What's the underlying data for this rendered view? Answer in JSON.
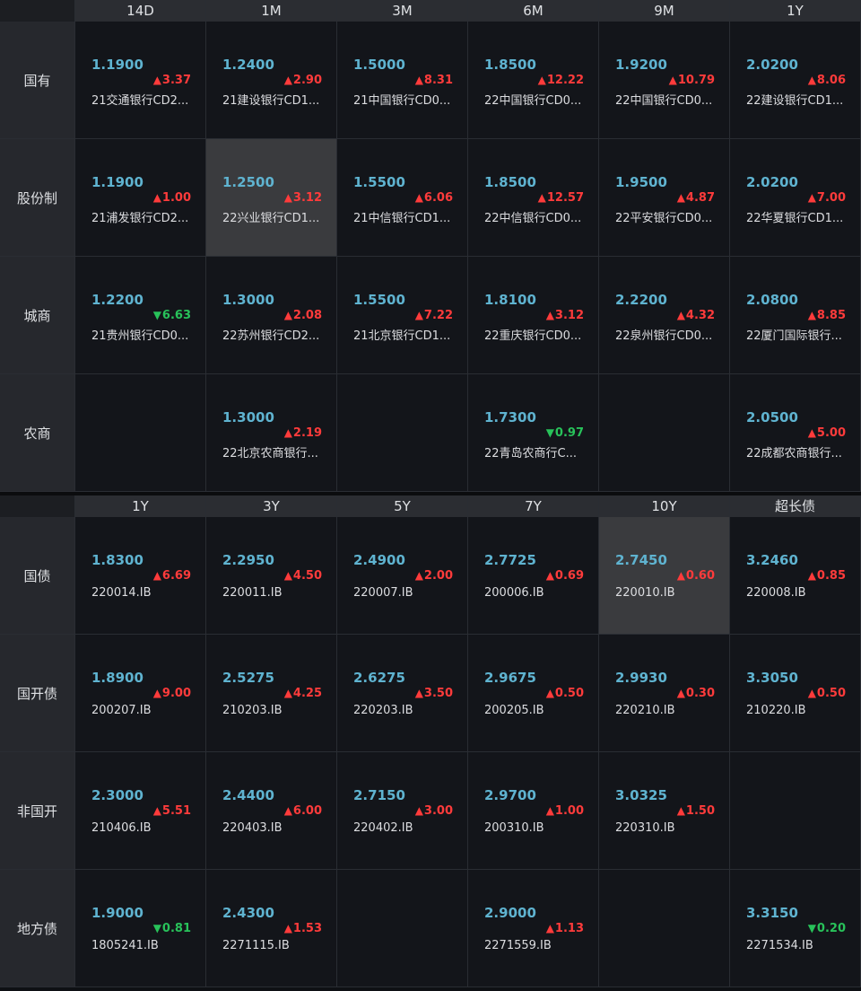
{
  "section1": {
    "columns": [
      "14D",
      "1M",
      "3M",
      "6M",
      "9M",
      "1Y"
    ],
    "rows": [
      {
        "label": "国有",
        "cells": [
          {
            "value": "1.1900",
            "dir": "up",
            "change": "3.37",
            "name": "21交通银行CD2..."
          },
          {
            "value": "1.2400",
            "dir": "up",
            "change": "2.90",
            "name": "21建设银行CD1..."
          },
          {
            "value": "1.5000",
            "dir": "up",
            "change": "8.31",
            "name": "21中国银行CD0..."
          },
          {
            "value": "1.8500",
            "dir": "up",
            "change": "12.22",
            "name": "22中国银行CD0..."
          },
          {
            "value": "1.9200",
            "dir": "up",
            "change": "10.79",
            "name": "22中国银行CD0..."
          },
          {
            "value": "2.0200",
            "dir": "up",
            "change": "8.06",
            "name": "22建设银行CD1..."
          }
        ]
      },
      {
        "label": "股份制",
        "cells": [
          {
            "value": "1.1900",
            "dir": "up",
            "change": "1.00",
            "name": "21浦发银行CD2..."
          },
          {
            "value": "1.2500",
            "dir": "up",
            "change": "3.12",
            "name": "22兴业银行CD1...",
            "highlight": true
          },
          {
            "value": "1.5500",
            "dir": "up",
            "change": "6.06",
            "name": "21中信银行CD1..."
          },
          {
            "value": "1.8500",
            "dir": "up",
            "change": "12.57",
            "name": "22中信银行CD0..."
          },
          {
            "value": "1.9500",
            "dir": "up",
            "change": "4.87",
            "name": "22平安银行CD0..."
          },
          {
            "value": "2.0200",
            "dir": "up",
            "change": "7.00",
            "name": "22华夏银行CD1..."
          }
        ]
      },
      {
        "label": "城商",
        "cells": [
          {
            "value": "1.2200",
            "dir": "down",
            "change": "6.63",
            "name": "21贵州银行CD0..."
          },
          {
            "value": "1.3000",
            "dir": "up",
            "change": "2.08",
            "name": "22苏州银行CD2..."
          },
          {
            "value": "1.5500",
            "dir": "up",
            "change": "7.22",
            "name": "21北京银行CD1..."
          },
          {
            "value": "1.8100",
            "dir": "up",
            "change": "3.12",
            "name": "22重庆银行CD0..."
          },
          {
            "value": "2.2200",
            "dir": "up",
            "change": "4.32",
            "name": "22泉州银行CD0..."
          },
          {
            "value": "2.0800",
            "dir": "up",
            "change": "8.85",
            "name": "22厦门国际银行..."
          }
        ]
      },
      {
        "label": "农商",
        "cells": [
          null,
          {
            "value": "1.3000",
            "dir": "up",
            "change": "2.19",
            "name": "22北京农商银行..."
          },
          null,
          {
            "value": "1.7300",
            "dir": "down",
            "change": "0.97",
            "name": "22青岛农商行C..."
          },
          null,
          {
            "value": "2.0500",
            "dir": "up",
            "change": "5.00",
            "name": "22成都农商银行..."
          }
        ]
      }
    ]
  },
  "section2": {
    "columns": [
      "1Y",
      "3Y",
      "5Y",
      "7Y",
      "10Y",
      "超长债"
    ],
    "rows": [
      {
        "label": "国债",
        "cells": [
          {
            "value": "1.8300",
            "dir": "up",
            "change": "6.69",
            "name": "220014.IB"
          },
          {
            "value": "2.2950",
            "dir": "up",
            "change": "4.50",
            "name": "220011.IB"
          },
          {
            "value": "2.4900",
            "dir": "up",
            "change": "2.00",
            "name": "220007.IB"
          },
          {
            "value": "2.7725",
            "dir": "up",
            "change": "0.69",
            "name": "200006.IB"
          },
          {
            "value": "2.7450",
            "dir": "up",
            "change": "0.60",
            "name": "220010.IB",
            "highlight": true
          },
          {
            "value": "3.2460",
            "dir": "up",
            "change": "0.85",
            "name": "220008.IB"
          }
        ]
      },
      {
        "label": "国开债",
        "cells": [
          {
            "value": "1.8900",
            "dir": "up",
            "change": "9.00",
            "name": "200207.IB"
          },
          {
            "value": "2.5275",
            "dir": "up",
            "change": "4.25",
            "name": "210203.IB"
          },
          {
            "value": "2.6275",
            "dir": "up",
            "change": "3.50",
            "name": "220203.IB"
          },
          {
            "value": "2.9675",
            "dir": "up",
            "change": "0.50",
            "name": "200205.IB"
          },
          {
            "value": "2.9930",
            "dir": "up",
            "change": "0.30",
            "name": "220210.IB"
          },
          {
            "value": "3.3050",
            "dir": "up",
            "change": "0.50",
            "name": "210220.IB"
          }
        ]
      },
      {
        "label": "非国开",
        "cells": [
          {
            "value": "2.3000",
            "dir": "up",
            "change": "5.51",
            "name": "210406.IB"
          },
          {
            "value": "2.4400",
            "dir": "up",
            "change": "6.00",
            "name": "220403.IB"
          },
          {
            "value": "2.7150",
            "dir": "up",
            "change": "3.00",
            "name": "220402.IB"
          },
          {
            "value": "2.9700",
            "dir": "up",
            "change": "1.00",
            "name": "200310.IB"
          },
          {
            "value": "3.0325",
            "dir": "up",
            "change": "1.50",
            "name": "220310.IB"
          },
          null
        ]
      },
      {
        "label": "地方债",
        "cells": [
          {
            "value": "1.9000",
            "dir": "down",
            "change": "0.81",
            "name": "1805241.IB"
          },
          {
            "value": "2.4300",
            "dir": "up",
            "change": "1.53",
            "name": "2271115.IB"
          },
          null,
          {
            "value": "2.9000",
            "dir": "up",
            "change": "1.13",
            "name": "2271559.IB"
          },
          null,
          {
            "value": "3.3150",
            "dir": "down",
            "change": "0.20",
            "name": "2271534.IB"
          }
        ]
      }
    ]
  },
  "glyphs": {
    "up": "▲",
    "down": "▼"
  },
  "colors": {
    "up": "#ff3b3b",
    "down": "#28c25a",
    "value": "#5fb3d0"
  }
}
